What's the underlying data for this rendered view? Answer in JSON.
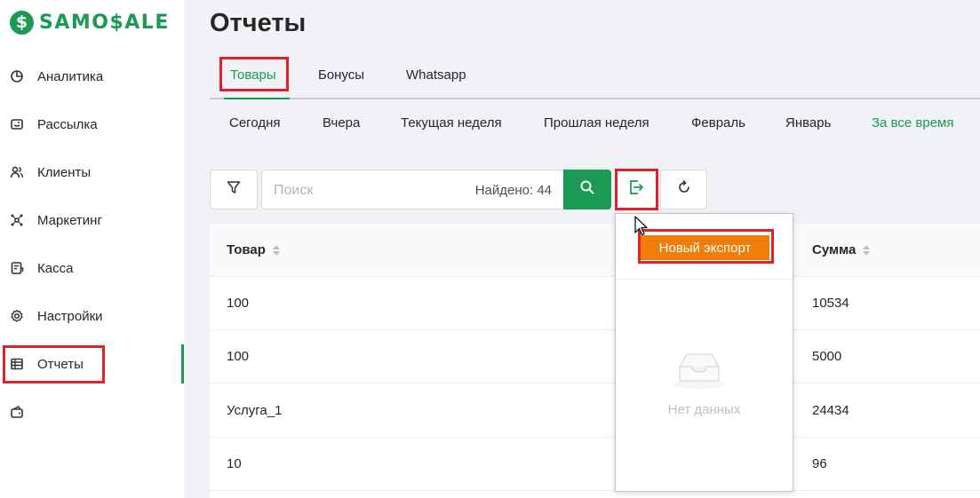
{
  "brand": {
    "logo_mark": "$",
    "logo_text": "SAMO$ALE",
    "color": "#1a9a52"
  },
  "sidebar": {
    "items": [
      {
        "label": "Аналитика",
        "icon": "pie-chart-icon"
      },
      {
        "label": "Рассылка",
        "icon": "mail-icon"
      },
      {
        "label": "Клиенты",
        "icon": "users-icon"
      },
      {
        "label": "Маркетинг",
        "icon": "network-icon"
      },
      {
        "label": "Касса",
        "icon": "cash-register-icon"
      },
      {
        "label": "Настройки",
        "icon": "gear-icon"
      },
      {
        "label": "Отчеты",
        "icon": "table-icon",
        "active": true
      },
      {
        "label": "",
        "icon": "wallet-icon"
      }
    ]
  },
  "page": {
    "title": "Отчеты"
  },
  "tabs": [
    {
      "label": "Товары",
      "active": true
    },
    {
      "label": "Бонусы"
    },
    {
      "label": "Whatsapp"
    }
  ],
  "periods": [
    {
      "label": "Сегодня"
    },
    {
      "label": "Вчера"
    },
    {
      "label": "Текущая неделя"
    },
    {
      "label": "Прошлая неделя"
    },
    {
      "label": "Февраль"
    },
    {
      "label": "Январь"
    },
    {
      "label": "За все время",
      "active": true
    }
  ],
  "toolbar": {
    "search_placeholder": "Поиск",
    "found_text": "Найдено: 44"
  },
  "table": {
    "columns": [
      "Товар",
      "Сумма"
    ],
    "rows": [
      {
        "product": "100",
        "sum": "10534"
      },
      {
        "product": "100",
        "sum": "5000"
      },
      {
        "product": "Услуга_1",
        "sum": "24434"
      },
      {
        "product": "10",
        "sum": "96"
      }
    ]
  },
  "export_dropdown": {
    "new_export_label": "Новый экспорт",
    "empty_text": "Нет данных"
  },
  "colors": {
    "accent": "#1a9a52",
    "highlight": "#e0202a",
    "export_button": "#f07d0a"
  }
}
